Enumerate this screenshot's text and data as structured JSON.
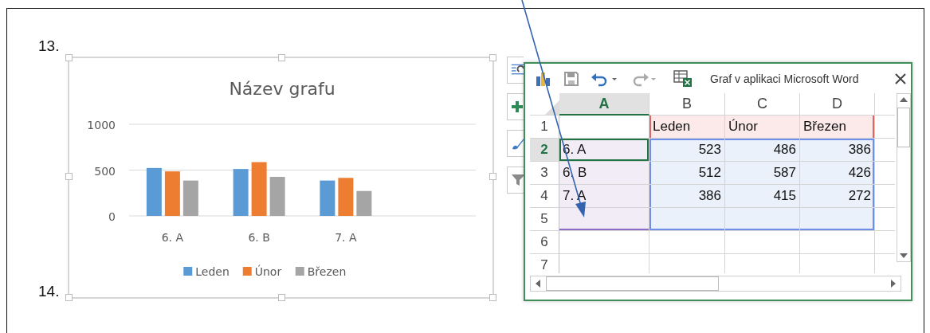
{
  "list_numbers": [
    "13.",
    "14."
  ],
  "chart": {
    "chart_data": {
      "type": "bar",
      "title": "Název grafu",
      "categories": [
        "6. A",
        "6. B",
        "7. A"
      ],
      "series": [
        {
          "name": "Leden",
          "color": "#5b9bd5",
          "values": [
            523,
            512,
            386
          ]
        },
        {
          "name": "Únor",
          "color": "#ed7d31",
          "values": [
            486,
            587,
            415
          ]
        },
        {
          "name": "Březen",
          "color": "#a5a5a5",
          "values": [
            386,
            426,
            272
          ]
        }
      ],
      "ylim": [
        0,
        1000
      ],
      "yticks": [
        0,
        500,
        1000
      ],
      "legend": "bottom"
    }
  },
  "sheet_window": {
    "title": "Graf v aplikaci Microsoft Word",
    "columns": [
      {
        "label": "A",
        "selected": true
      },
      {
        "label": "B",
        "selected": false
      },
      {
        "label": "C",
        "selected": false
      },
      {
        "label": "D",
        "selected": false
      }
    ],
    "rows": [
      {
        "label": "1",
        "selected": false,
        "cells": [
          {
            "kind": "blank",
            "selected": false
          },
          {
            "text": "Leden",
            "kind": "series",
            "selected": false
          },
          {
            "text": "Únor",
            "kind": "series",
            "selected": false
          },
          {
            "text": "Březen",
            "kind": "series",
            "selected": false
          }
        ]
      },
      {
        "label": "2",
        "selected": true,
        "cells": [
          {
            "text": "6. A",
            "kind": "category",
            "selected": true
          },
          {
            "text": "523",
            "kind": "value",
            "selected": false
          },
          {
            "text": "486",
            "kind": "value",
            "selected": false
          },
          {
            "text": "386",
            "kind": "value",
            "selected": false
          }
        ]
      },
      {
        "label": "3",
        "selected": false,
        "cells": [
          {
            "text": "6. B",
            "kind": "category",
            "selected": false
          },
          {
            "text": "512",
            "kind": "value",
            "selected": false
          },
          {
            "text": "587",
            "kind": "value",
            "selected": false
          },
          {
            "text": "426",
            "kind": "value",
            "selected": false
          }
        ]
      },
      {
        "label": "4",
        "selected": false,
        "cells": [
          {
            "text": "7. A",
            "kind": "category",
            "selected": false
          },
          {
            "text": "386",
            "kind": "value",
            "selected": false
          },
          {
            "text": "415",
            "kind": "value",
            "selected": false
          },
          {
            "text": "272",
            "kind": "value",
            "selected": false
          }
        ]
      },
      {
        "label": "5",
        "selected": false,
        "cells": [
          {
            "kind": "category",
            "selected": false
          },
          {
            "kind": "value",
            "selected": false
          },
          {
            "kind": "value",
            "selected": false
          },
          {
            "kind": "value",
            "selected": false
          }
        ]
      },
      {
        "label": "6",
        "selected": false
      },
      {
        "label": "7",
        "selected": false
      }
    ]
  }
}
